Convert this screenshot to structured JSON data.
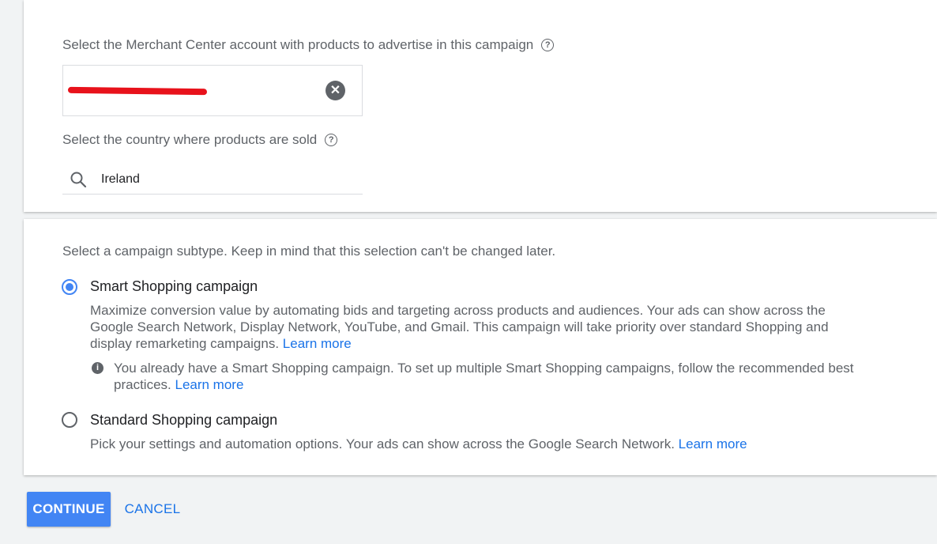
{
  "account_section": {
    "merchant_label": "Select the Merchant Center account with products to advertise in this campaign",
    "merchant_help_icon": "help-circle-icon",
    "merchant_clear_icon": "clear-circle-icon",
    "country_label": "Select the country where products are sold",
    "country_help_icon": "help-circle-icon",
    "country_search_icon": "search-icon",
    "country_value": "Ireland"
  },
  "subtype_section": {
    "prompt": "Select a campaign subtype. Keep in mind that this selection can't be changed later.",
    "options": [
      {
        "title": "Smart Shopping campaign",
        "selected": true,
        "description": "Maximize conversion value by automating bids and targeting across products and audiences. Your ads can show across the Google Search Network, Display Network, YouTube, and Gmail. This campaign will take priority over standard Shopping and display remarketing campaigns.",
        "link": "Learn more",
        "notice": "You already have a Smart Shopping campaign. To set up multiple Smart Shopping campaigns, follow the recommended best practices.",
        "notice_link": "Learn more"
      },
      {
        "title": "Standard Shopping campaign",
        "selected": false,
        "description": "Pick your settings and automation options. Your ads can show across the Google Search Network.",
        "link": "Learn more"
      }
    ]
  },
  "actions": {
    "continue_label": "CONTINUE",
    "cancel_label": "CANCEL"
  },
  "colors": {
    "accent": "#4285f4",
    "link": "#1a73e8",
    "redaction": "#e8121b"
  }
}
